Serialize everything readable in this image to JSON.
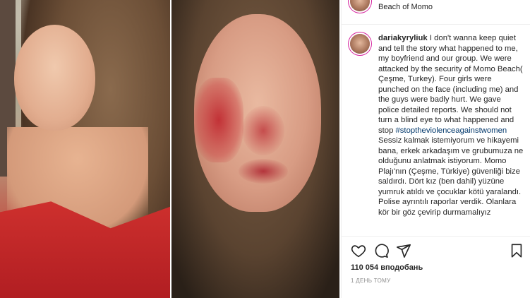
{
  "post": {
    "location": "Beach of Momo",
    "caption": {
      "username": "dariakyryliuk",
      "text_part1": " I don't wanna keep quiet and tell the story what happened to me, my boyfriend and our group. We were attacked by the security of Momo Beach( Çeşme, Turkey). Four girls were punched on the face (including me) and the guys were badly hurt. We gave police detailed reports. We should not turn a blind eye to what happened and stop ",
      "hashtag": "#stoptheviolenceagainstwomen",
      "text_part2": " Sessiz kalmak istemiyorum ve hikayemi bana, erkek arkadaşım ve grubumuza ne olduğunu anlatmak istiyorum. Momo Plajı'nın (Çeşme, Türkiye) güvenliği bize saldırdı. Dört kız (ben dahil) yüzüne yumruk atıldı ve çocuklar kötü yaralandı. Polise ayrıntılı raporlar verdik. Olanlara kör bir göz çevirip durmamalıyız"
    },
    "likes": "110 054 вподобань",
    "time": "1 день тому"
  },
  "icons": {
    "like": "heart-icon",
    "comment": "comment-icon",
    "share": "share-icon",
    "save": "bookmark-icon"
  }
}
